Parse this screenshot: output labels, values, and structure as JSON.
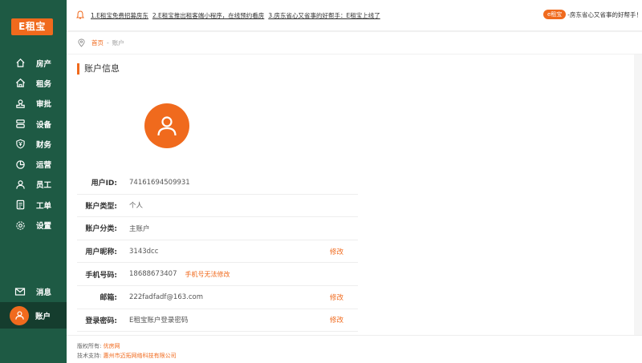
{
  "sidebar": {
    "logo": "E租宝",
    "items": [
      {
        "label": "房产",
        "icon": "home-icon"
      },
      {
        "label": "租务",
        "icon": "house-outline-icon"
      },
      {
        "label": "审批",
        "icon": "stamp-icon"
      },
      {
        "label": "设备",
        "icon": "device-icon"
      },
      {
        "label": "财务",
        "icon": "yuan-shield-icon"
      },
      {
        "label": "运营",
        "icon": "pie-chart-icon"
      },
      {
        "label": "员工",
        "icon": "person-icon"
      },
      {
        "label": "工单",
        "icon": "document-icon"
      },
      {
        "label": "设置",
        "icon": "gear-icon"
      }
    ],
    "bottom": [
      {
        "label": "消息",
        "icon": "mail-icon"
      },
      {
        "label": "账户",
        "icon": "avatar-icon"
      }
    ]
  },
  "notice": {
    "items": [
      "1.E租宝免费招募房东",
      "2.E租宝推出租客端小程序，在线预约看房",
      "3.房东省心又省事的好帮手：E租宝上线了"
    ],
    "promo_tag": "e租宝",
    "promo_text": "-房东省心又省事的好帮手！"
  },
  "breadcrumb": {
    "home": "首页",
    "separator": "-",
    "current": "账户"
  },
  "main": {
    "title": "账户信息",
    "rows": [
      {
        "label": "用户ID:",
        "value": "74161694509931",
        "note": "",
        "edit": ""
      },
      {
        "label": "账户类型:",
        "value": "个人",
        "note": "",
        "edit": ""
      },
      {
        "label": "账户分类:",
        "value": "主账户",
        "note": "",
        "edit": ""
      },
      {
        "label": "用户昵称:",
        "value": "3143dcc",
        "note": "",
        "edit": "修改"
      },
      {
        "label": "手机号码:",
        "value": "18688673407",
        "note": "手机号无法修改",
        "edit": ""
      },
      {
        "label": "邮箱:",
        "value": "222fadfadf@163.com",
        "note": "",
        "edit": "修改"
      },
      {
        "label": "登录密码:",
        "value": "E租宝账户登录密码",
        "note": "",
        "edit": "修改"
      }
    ]
  },
  "footer": {
    "copyright_label": "版权所有:",
    "copyright_link": "优房网",
    "support_label": "技术支持:",
    "support_link": "惠州市迈拓网络科技有限公司"
  },
  "colors": {
    "sidebar_bg": "#1e5a44",
    "accent": "#f06a1d"
  }
}
